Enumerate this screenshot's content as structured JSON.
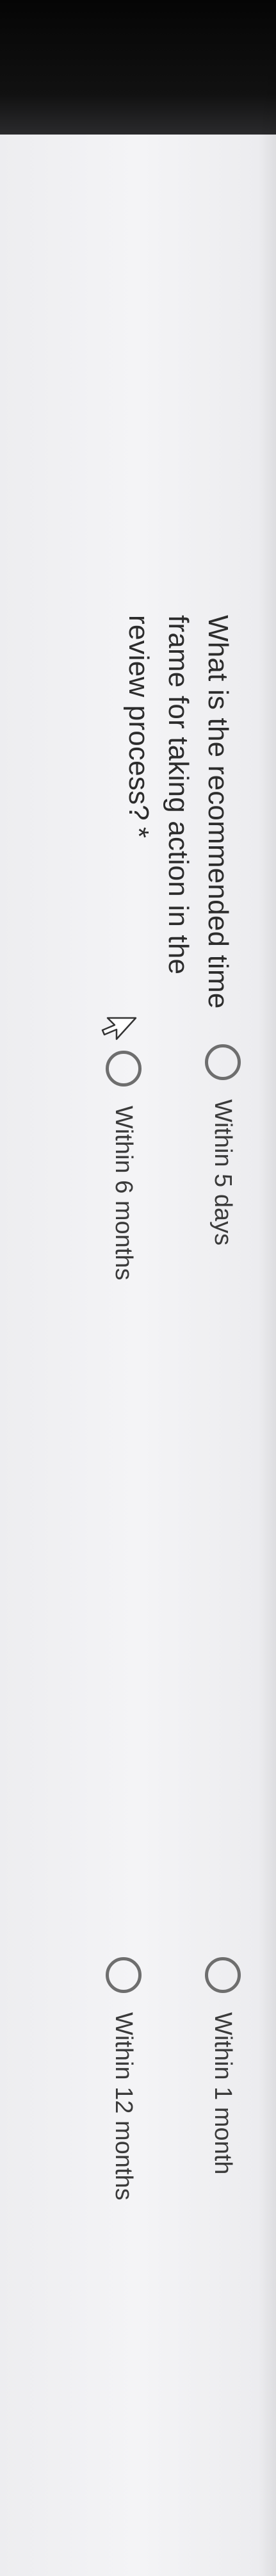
{
  "question": {
    "text": "What is the recommended time frame for taking action in the review process?",
    "required_marker": "*"
  },
  "options": [
    {
      "label": "Within 5 days",
      "selected": false
    },
    {
      "label": "Within 6 months",
      "selected": false
    },
    {
      "label": "Within 1 month",
      "selected": false
    },
    {
      "label": "Within 12 months",
      "selected": false
    }
  ],
  "colors": {
    "background": "#ececee",
    "text": "#2c2c2c",
    "radio_border": "#6e6e6e",
    "bezel": "#050505"
  },
  "icons": {
    "cursor": "mouse-pointer-icon"
  }
}
